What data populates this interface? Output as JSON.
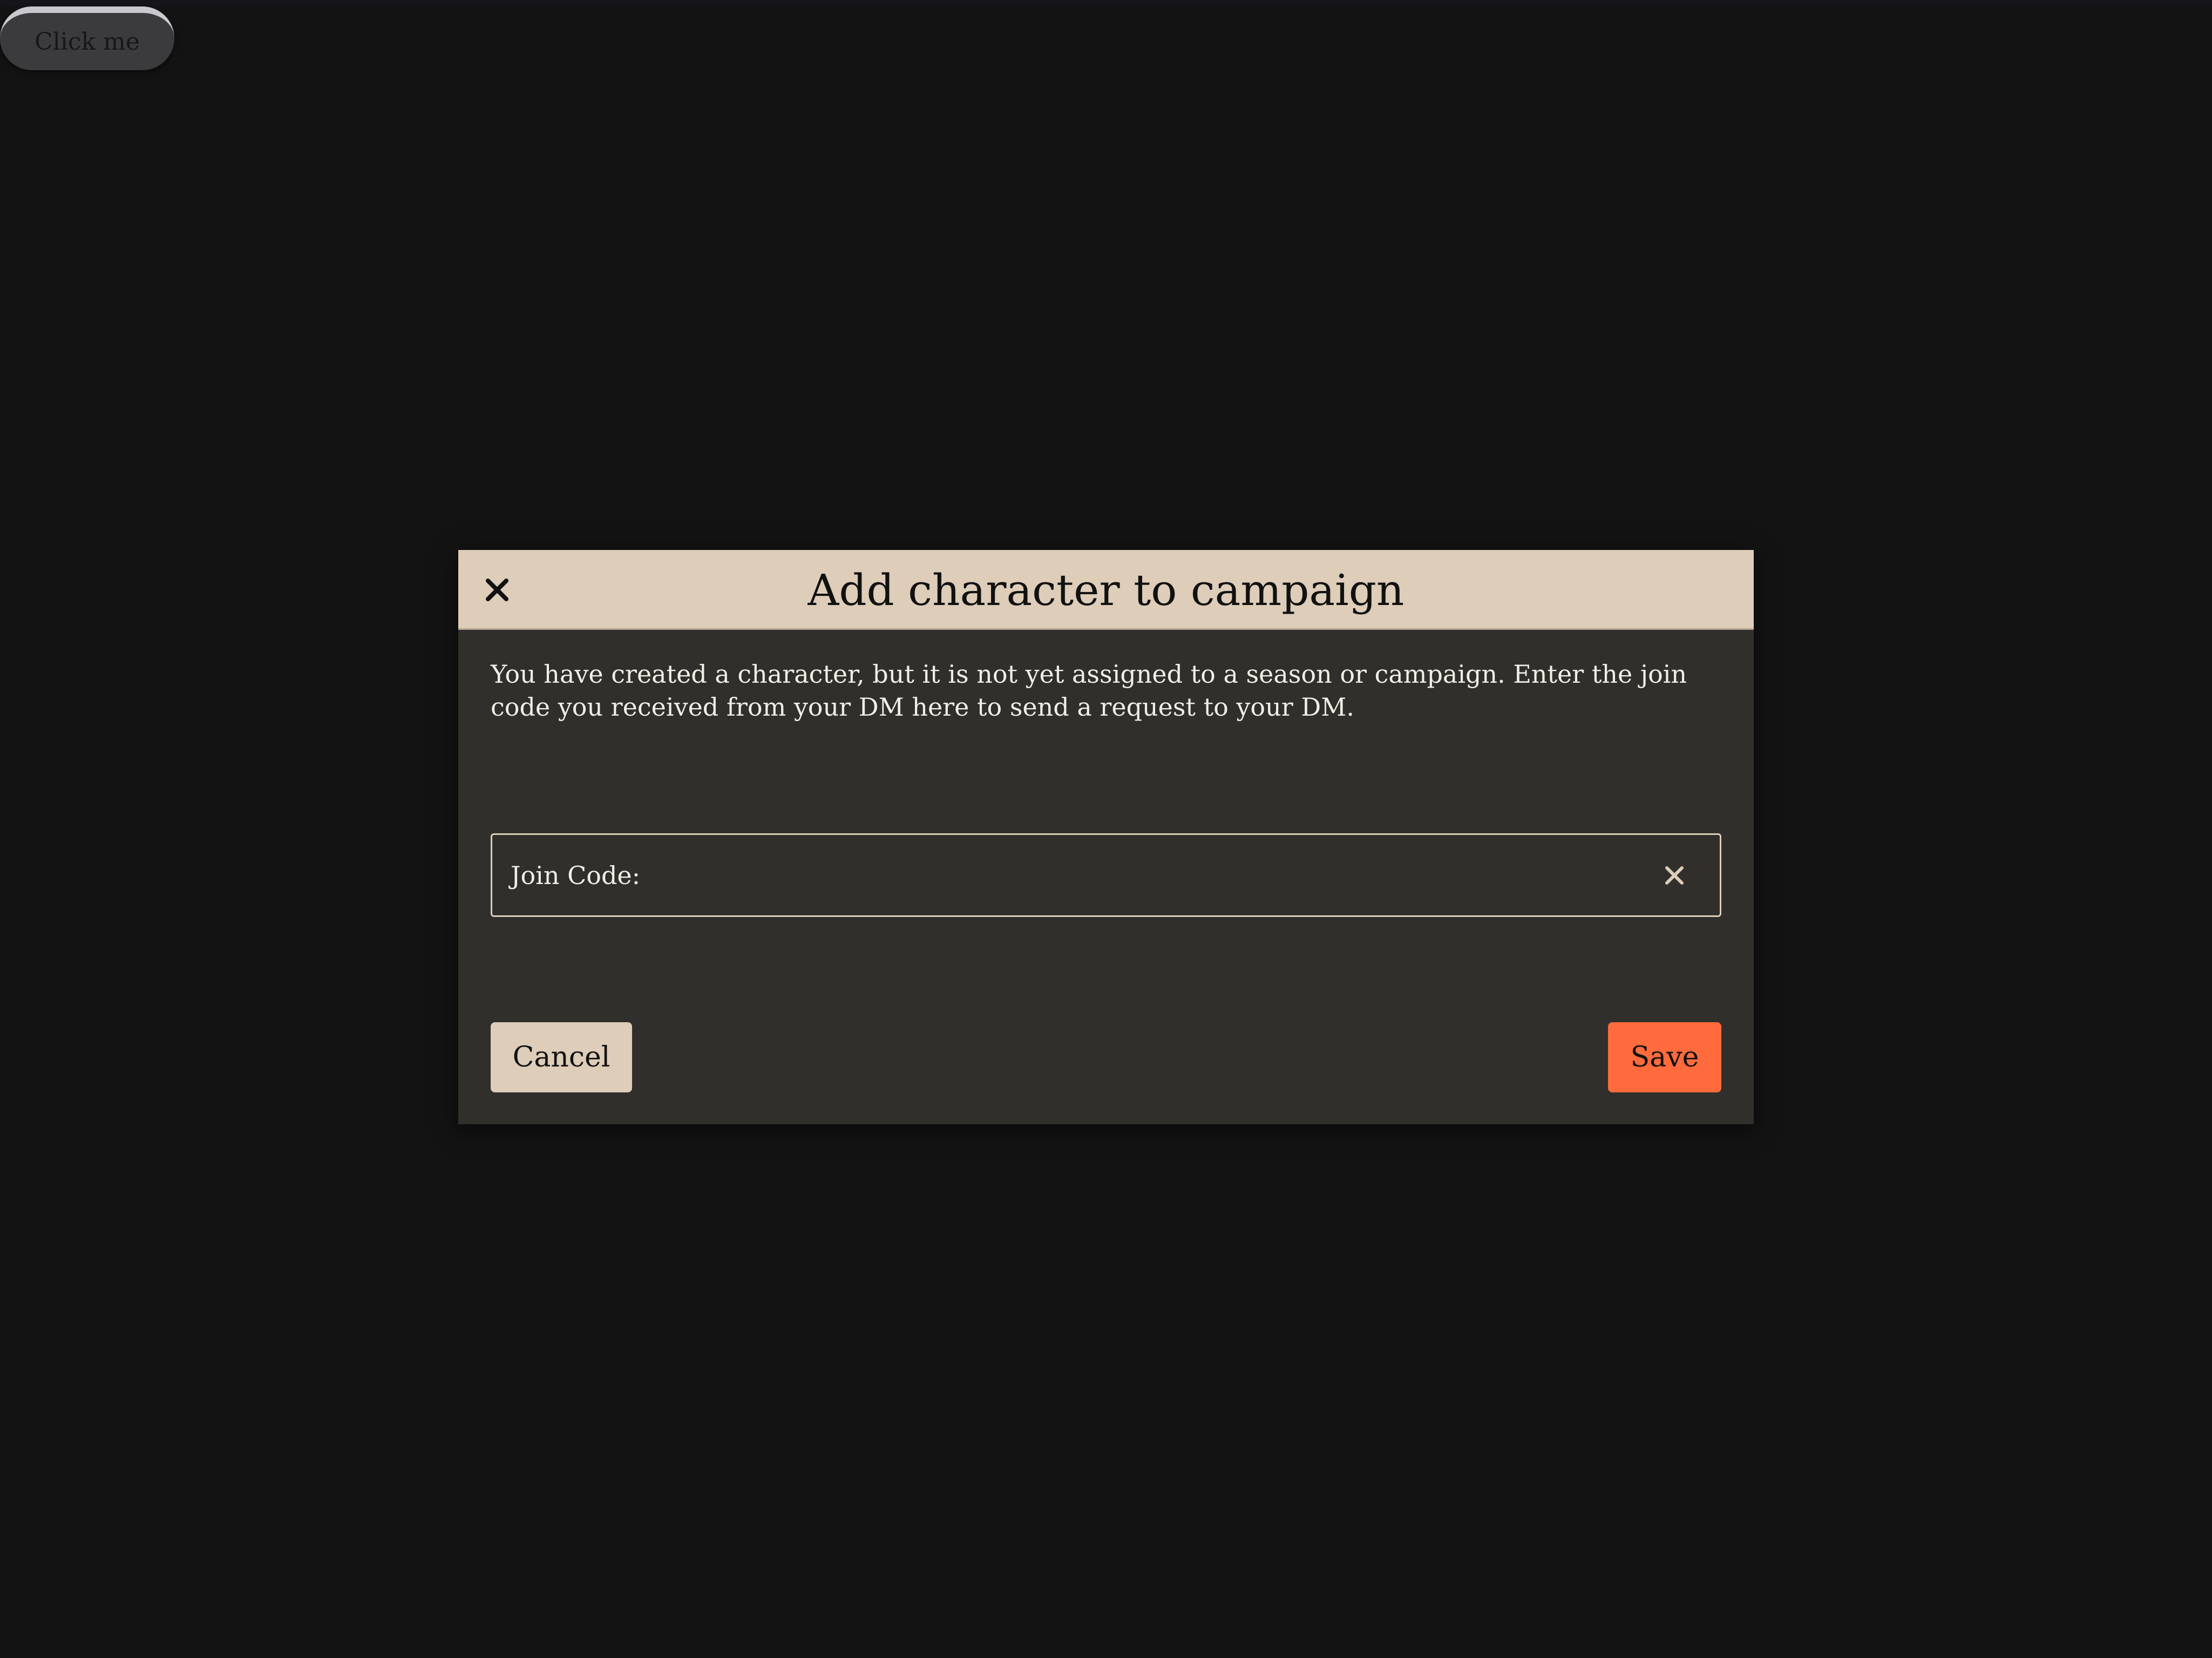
{
  "page": {
    "click_button_label": "Click me"
  },
  "modal": {
    "title": "Add character to campaign",
    "close_icon": "close-icon",
    "description": "You have created a character, but it is not yet assigned to a season or campaign. Enter the join code you received from your DM here to send a request to your DM.",
    "join_code": {
      "label": "Join Code:",
      "value": "",
      "clear_icon": "clear-icon"
    },
    "cancel_label": "Cancel",
    "save_label": "Save"
  },
  "colors": {
    "background": "#131313",
    "modal_body": "#302f2b",
    "header_beige": "#ddcdb9",
    "accent_orange": "#ff6b3d",
    "text_light": "#f2eee6"
  }
}
